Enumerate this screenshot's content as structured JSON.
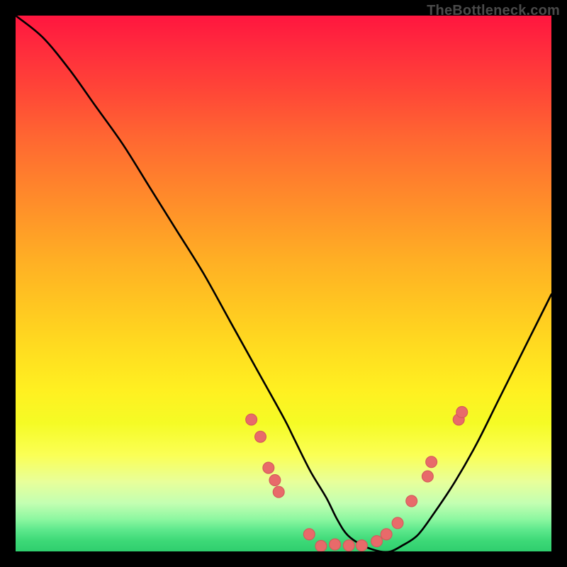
{
  "watermark": "TheBottleneck.com",
  "colors": {
    "background": "#000000",
    "curve_stroke": "#000000",
    "dot_fill": "#e86a6a",
    "dot_stroke": "#d45a5a"
  },
  "chart_data": {
    "type": "line",
    "title": "",
    "xlabel": "",
    "ylabel": "",
    "xlim": [
      0,
      100
    ],
    "ylim": [
      0,
      100
    ],
    "series": [
      {
        "name": "bottleneck-curve",
        "x": [
          0,
          5,
          10,
          15,
          20,
          25,
          30,
          35,
          40,
          45,
          50,
          52,
          55,
          58,
          60,
          62,
          65,
          68,
          70,
          72,
          75,
          78,
          82,
          86,
          90,
          94,
          98,
          100
        ],
        "y": [
          100,
          96,
          90,
          83,
          76,
          68,
          60,
          52,
          43,
          34,
          25,
          21,
          15,
          10,
          6,
          3,
          1,
          0,
          0,
          1,
          3,
          7,
          13,
          20,
          28,
          36,
          44,
          48
        ]
      }
    ],
    "points": [
      {
        "x": 44.0,
        "y": 24.6
      },
      {
        "x": 45.7,
        "y": 21.4
      },
      {
        "x": 47.2,
        "y": 15.6
      },
      {
        "x": 48.4,
        "y": 13.3
      },
      {
        "x": 49.1,
        "y": 11.1
      },
      {
        "x": 54.8,
        "y": 3.2
      },
      {
        "x": 57.0,
        "y": 1.0
      },
      {
        "x": 59.6,
        "y": 1.3
      },
      {
        "x": 62.2,
        "y": 1.1
      },
      {
        "x": 64.6,
        "y": 1.1
      },
      {
        "x": 67.4,
        "y": 1.9
      },
      {
        "x": 69.2,
        "y": 3.2
      },
      {
        "x": 71.3,
        "y": 5.3
      },
      {
        "x": 73.9,
        "y": 9.4
      },
      {
        "x": 76.9,
        "y": 14.0
      },
      {
        "x": 77.6,
        "y": 16.7
      },
      {
        "x": 82.7,
        "y": 24.6
      },
      {
        "x": 83.3,
        "y": 26.0
      }
    ]
  }
}
